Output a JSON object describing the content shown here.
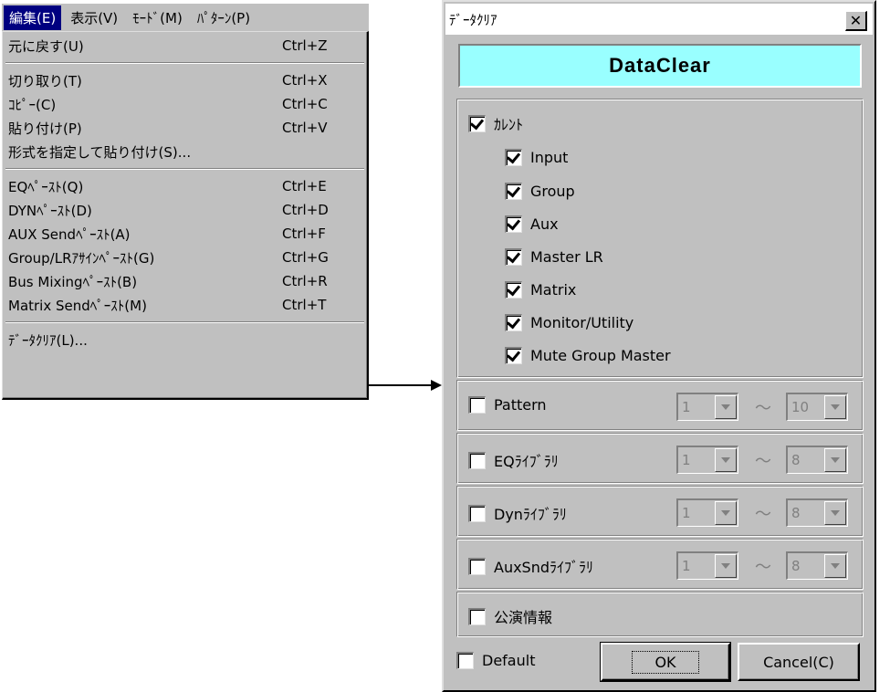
{
  "menubar": {
    "items": [
      "編集(E)",
      "表示(V)",
      "ﾓｰﾄﾞ(M)",
      "ﾊﾟﾀｰﾝ(P)"
    ]
  },
  "menu": {
    "undo": {
      "label": "元に戻す(U)",
      "shortcut": "Ctrl+Z"
    },
    "cut": {
      "label": "切り取り(T)",
      "shortcut": "Ctrl+X"
    },
    "copy": {
      "label": "ｺﾋﾟｰ(C)",
      "shortcut": "Ctrl+C"
    },
    "paste": {
      "label": "貼り付け(P)",
      "shortcut": "Ctrl+V"
    },
    "paste_special": {
      "label": "形式を指定して貼り付け(S)...",
      "shortcut": ""
    },
    "eq_paste": {
      "label": "EQﾍﾟｰｽﾄ(Q)",
      "shortcut": "Ctrl+E"
    },
    "dyn_paste": {
      "label": "DYNﾍﾟｰｽﾄ(D)",
      "shortcut": "Ctrl+D"
    },
    "aux_paste": {
      "label": "AUX Sendﾍﾟｰｽﾄ(A)",
      "shortcut": "Ctrl+F"
    },
    "group_paste": {
      "label": "Group/LRｱｻｲﾝﾍﾟｰｽﾄ(G)",
      "shortcut": "Ctrl+G"
    },
    "bus_paste": {
      "label": "Bus Mixingﾍﾟｰｽﾄ(B)",
      "shortcut": "Ctrl+R"
    },
    "matrix_paste": {
      "label": "Matrix Sendﾍﾟｰｽﾄ(M)",
      "shortcut": "Ctrl+T"
    },
    "data_clear": {
      "label": "ﾃﾞｰﾀｸﾘｱ(L)..."
    }
  },
  "dialog": {
    "title": "ﾃﾞｰﾀｸﾘｱ",
    "close": "✕",
    "header": "DataClear",
    "current": {
      "label": "ｶﾚﾝﾄ",
      "checked": true,
      "items": [
        {
          "label": "Input",
          "checked": true
        },
        {
          "label": "Group",
          "checked": true
        },
        {
          "label": "Aux",
          "checked": true
        },
        {
          "label": "Master LR",
          "checked": true
        },
        {
          "label": "Matrix",
          "checked": true
        },
        {
          "label": "Monitor/Utility",
          "checked": true
        },
        {
          "label": "Mute Group Master",
          "checked": true
        }
      ]
    },
    "ranges": [
      {
        "label": "Pattern",
        "checked": false,
        "from": "1",
        "to": "10"
      },
      {
        "label": "EQﾗｲﾌﾞﾗﾘ",
        "checked": false,
        "from": "1",
        "to": "8"
      },
      {
        "label": "Dynﾗｲﾌﾞﾗﾘ",
        "checked": false,
        "from": "1",
        "to": "8"
      },
      {
        "label": "AuxSndﾗｲﾌﾞﾗﾘ",
        "checked": false,
        "from": "1",
        "to": "8"
      }
    ],
    "range_separator": "〜",
    "performance_info": {
      "label": "公演情報",
      "checked": false
    },
    "default_cb": {
      "label": "Default",
      "checked": false
    },
    "ok_label": "OK",
    "cancel_label": "Cancel(C)"
  }
}
